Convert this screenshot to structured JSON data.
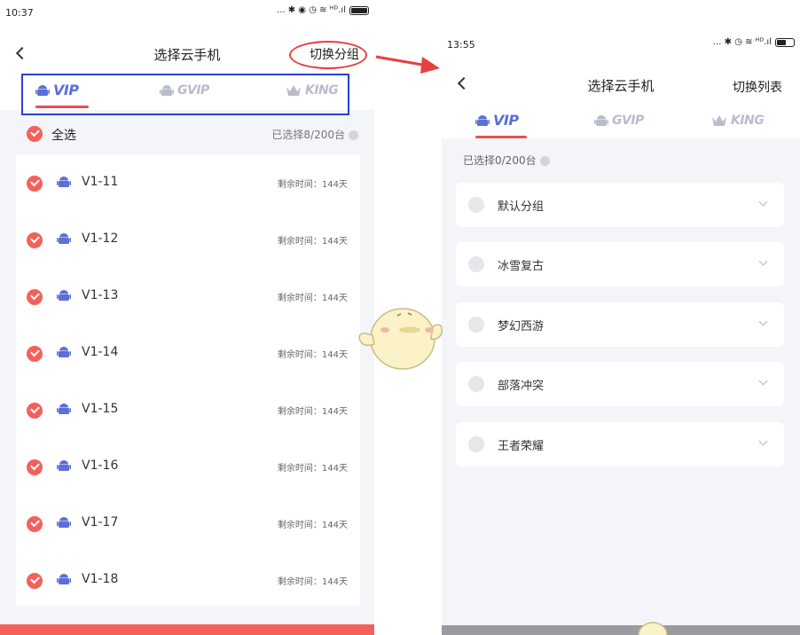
{
  "left": {
    "status": {
      "time": "10:37",
      "icons": "... ✱ ◉ ◷ ≋ ᴴᴰ.ıl"
    },
    "nav": {
      "title": "选择云手机",
      "action_label": "切换分组"
    },
    "tabs": [
      {
        "label": "VIP"
      },
      {
        "label": "GVIP"
      },
      {
        "label": "KING"
      }
    ],
    "select_all": {
      "label": "全选",
      "count": "已选择8/200台"
    },
    "devices": [
      {
        "name": "V1-11",
        "remaining": "剩余时间：144天"
      },
      {
        "name": "V1-12",
        "remaining": "剩余时间：144天"
      },
      {
        "name": "V1-13",
        "remaining": "剩余时间：144天"
      },
      {
        "name": "V1-14",
        "remaining": "剩余时间：144天"
      },
      {
        "name": "V1-15",
        "remaining": "剩余时间：144天"
      },
      {
        "name": "V1-16",
        "remaining": "剩余时间：144天"
      },
      {
        "name": "V1-17",
        "remaining": "剩余时间：144天"
      },
      {
        "name": "V1-18",
        "remaining": "剩余时间：144天"
      }
    ]
  },
  "right": {
    "status": {
      "time": "13:55",
      "icons": "... ✱ ◷ ≋ ᴴᴰ.ıl"
    },
    "nav": {
      "title": "选择云手机",
      "action_label": "切换列表"
    },
    "tabs": [
      {
        "label": "VIP"
      },
      {
        "label": "GVIP"
      },
      {
        "label": "KING"
      }
    ],
    "selected_summary": "已选择0/200台",
    "groups": [
      {
        "name": "默认分组"
      },
      {
        "name": "冰雪复古"
      },
      {
        "name": "梦幻西游"
      },
      {
        "name": "部落冲突"
      },
      {
        "name": "王者荣耀"
      }
    ]
  },
  "colors": {
    "accent_red": "#f4615b",
    "tab_active": "#5c6fd6",
    "tab_inactive": "#b8bccb",
    "annotation_blue": "#2741d8",
    "annotation_red": "#e83f3f"
  }
}
